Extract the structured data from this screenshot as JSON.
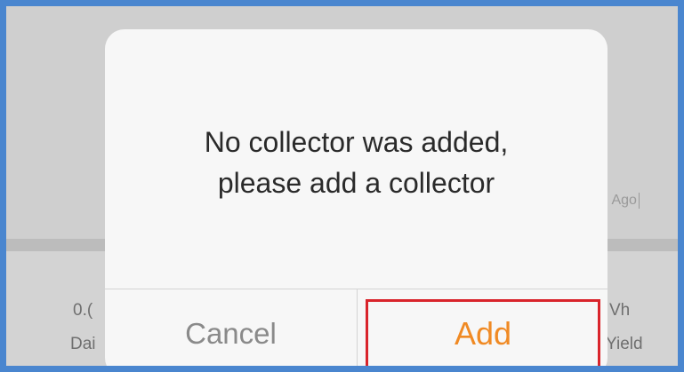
{
  "background": {
    "time_hint": "h Ago",
    "left_value": "0.(",
    "left_label": "Dai",
    "right_value": "Vh",
    "right_label": "Yield"
  },
  "dialog": {
    "message_line1": "No collector was added,",
    "message_line2": "please add a collector",
    "cancel_label": "Cancel",
    "add_label": "Add"
  },
  "colors": {
    "frame_border": "#4a86cf",
    "add_text": "#f08a24",
    "highlight_border": "#d9242b",
    "cancel_text": "#8a8a8a"
  }
}
